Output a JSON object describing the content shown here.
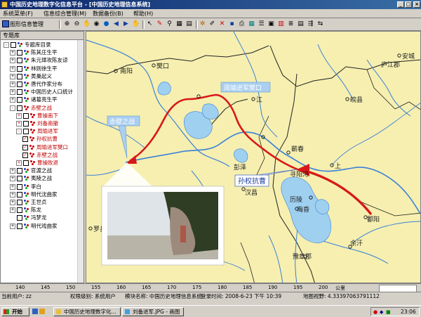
{
  "window": {
    "title": "中国历史地理数字化信息平台 - [中国历史地理信息系统]"
  },
  "menu": [
    {
      "label": "系统菜单(F)"
    },
    {
      "label": "信息综合管理(M)"
    },
    {
      "label": "数据备份(B)"
    },
    {
      "label": "帮助(H)"
    }
  ],
  "toolbar": {
    "tab_label": "图形信息管理"
  },
  "left_panel": {
    "header": "专题库",
    "tree": [
      {
        "label": "专题库目录",
        "level": 0,
        "expander": "-"
      },
      {
        "label": "陈其庄生平",
        "level": 1,
        "expander": "+"
      },
      {
        "label": "朱元璋攻陈友谅",
        "level": 1,
        "expander": "+"
      },
      {
        "label": "林则徐生平",
        "level": 1,
        "expander": "+"
      },
      {
        "label": "黄巢起义",
        "level": 1,
        "expander": "+"
      },
      {
        "label": "唐代作家分布",
        "level": 1,
        "expander": "+"
      },
      {
        "label": "中国历史人口统计",
        "level": 1,
        "expander": "+"
      },
      {
        "label": "诸葛亮生平",
        "level": 1,
        "expander": "+"
      },
      {
        "label": "赤壁之战",
        "level": 1,
        "expander": "-",
        "red": true
      },
      {
        "label": "曹操南下",
        "level": 2,
        "expander": "+",
        "red": true
      },
      {
        "label": "刘备南撤",
        "level": 2,
        "expander": "+",
        "red": true
      },
      {
        "label": "周瑜进军",
        "level": 2,
        "expander": "-",
        "red": true
      },
      {
        "label": "孙权抗曹",
        "level": 3,
        "checked": true,
        "red": true
      },
      {
        "label": "周瑜进军樊口",
        "level": 3,
        "checked": true,
        "red": true
      },
      {
        "label": "赤壁之战",
        "level": 3,
        "checked": true,
        "red": true
      },
      {
        "label": "曹操败退",
        "level": 2,
        "expander": "+",
        "red": true
      },
      {
        "label": "官渡之战",
        "level": 1,
        "expander": "+"
      },
      {
        "label": "夷陵之战",
        "level": 1,
        "expander": "+"
      },
      {
        "label": "李白",
        "level": 1,
        "expander": "+"
      },
      {
        "label": "明代沈曲家",
        "level": 1,
        "expander": "+"
      },
      {
        "label": "王世贞",
        "level": 1,
        "expander": "+"
      },
      {
        "label": "陈龙",
        "level": 1,
        "expander": "+"
      },
      {
        "label": "冯梦龙",
        "level": 1,
        "expander": ""
      },
      {
        "label": "明代戏曲家",
        "level": 1,
        "expander": "+"
      }
    ]
  },
  "map": {
    "callouts": {
      "chibi": "赤壁之战",
      "fankou": "周瑜进军樊口",
      "sunquan": "孙权抗曹"
    },
    "places": [
      "南阳",
      "汉川",
      "江",
      "宜州",
      "庐江郡",
      "当口",
      "皖县",
      "蕲春",
      "寻阳",
      "浔",
      "上",
      "彭泽",
      "历陵",
      "海昏",
      "豫章郡",
      "余汗",
      "巴陵",
      "鄱阳",
      "罗县",
      "新阳",
      "汉昌",
      "沙羡",
      "樊口",
      "安城"
    ]
  },
  "scale_ruler": {
    "ticks": [
      "140",
      "145",
      "150",
      "155",
      "160",
      "165",
      "170",
      "175",
      "180",
      "185",
      "190",
      "195",
      "200"
    ],
    "unit": "公里"
  },
  "status": {
    "current_user": "当前用户: zz",
    "permission": "权限级别: 系统用户",
    "module": "模块名称: 中国历史地理信息系统",
    "login_time": "登录时间: 2008-6-23 下午 10:39",
    "map_view": "地图视野: 4.33397063791112"
  },
  "taskbar": {
    "start": "开始",
    "tasks": [
      {
        "label": "中国历史地理数字化..."
      },
      {
        "label": "刘备进军.JPG - 画图"
      }
    ],
    "clock": "23:06"
  }
}
